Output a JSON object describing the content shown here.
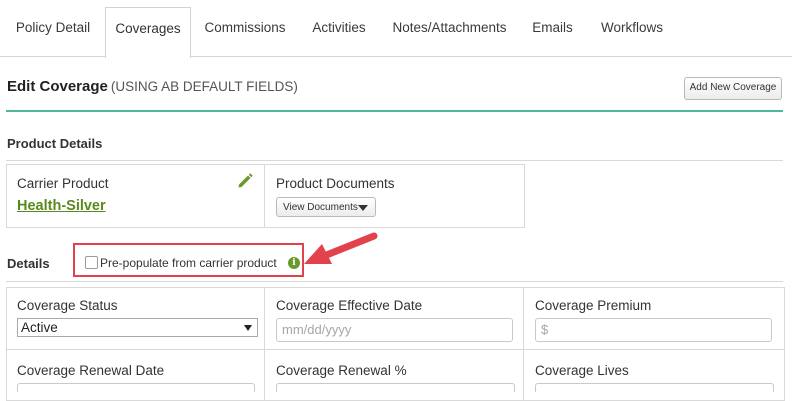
{
  "tabs": [
    {
      "label": "Policy Detail",
      "active": false
    },
    {
      "label": "Coverages",
      "active": true
    },
    {
      "label": "Commissions",
      "active": false
    },
    {
      "label": "Activities",
      "active": false
    },
    {
      "label": "Notes/Attachments",
      "active": false
    },
    {
      "label": "Emails",
      "active": false
    },
    {
      "label": "Workflows",
      "active": false
    }
  ],
  "header": {
    "title": "Edit Coverage",
    "subtitle": "(USING AB DEFAULT FIELDS)",
    "add_button_label": "Add New Coverage"
  },
  "product_details": {
    "section_title": "Product Details",
    "carrier_product_label": "Carrier Product",
    "carrier_product_value": "Health-Silver",
    "product_documents_label": "Product Documents",
    "view_documents_label": "View Documents"
  },
  "details": {
    "section_title": "Details",
    "prepopulate_label": "Pre-populate from carrier product",
    "prepopulate_checked": false,
    "info_glyph": "i"
  },
  "fields": {
    "coverage_status_label": "Coverage Status",
    "coverage_status_value": "Active",
    "effective_date_label": "Coverage Effective Date",
    "effective_date_placeholder": "mm/dd/yyyy",
    "premium_label": "Coverage Premium",
    "premium_placeholder": "$",
    "renewal_date_label": "Coverage Renewal Date",
    "renewal_pct_label": "Coverage Renewal %",
    "lives_label": "Coverage Lives"
  },
  "colors": {
    "accent_teal": "#4fb79c",
    "link_green": "#5a8a1e",
    "callout_red": "#e2424b"
  },
  "icons": [
    "pencil-icon",
    "caret-down-icon",
    "info-icon",
    "arrow-callout-icon"
  ]
}
